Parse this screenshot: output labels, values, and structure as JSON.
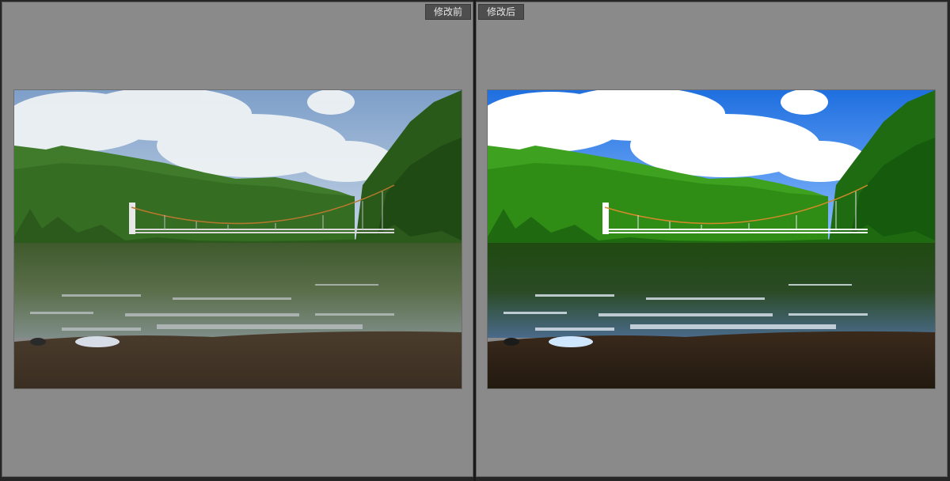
{
  "compare": {
    "before": {
      "label": "修改前",
      "image_icon": "landscape-photo-before"
    },
    "after": {
      "label": "修改后",
      "image_icon": "landscape-photo-after"
    }
  },
  "colors": {
    "pane_bg": "#8a8a8a",
    "tag_bg": "#4e4e4e",
    "tag_text": "#e6e6e6",
    "divider": "#1a1a1a"
  }
}
